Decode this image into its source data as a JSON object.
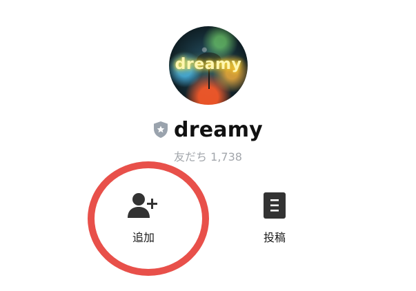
{
  "profile": {
    "avatar_text": "dreamy",
    "name": "dreamy",
    "friends_label": "友だち 1,738"
  },
  "actions": {
    "add_label": "追加",
    "post_label": "投稿"
  },
  "colors": {
    "highlight_ring": "#e8504a",
    "icon_dark": "#333333",
    "muted_text": "#a2a6ab",
    "shield": "#9aa3ad"
  },
  "icons": {
    "badge": "shield-star-icon",
    "add": "add-friend-icon",
    "post": "document-icon"
  }
}
